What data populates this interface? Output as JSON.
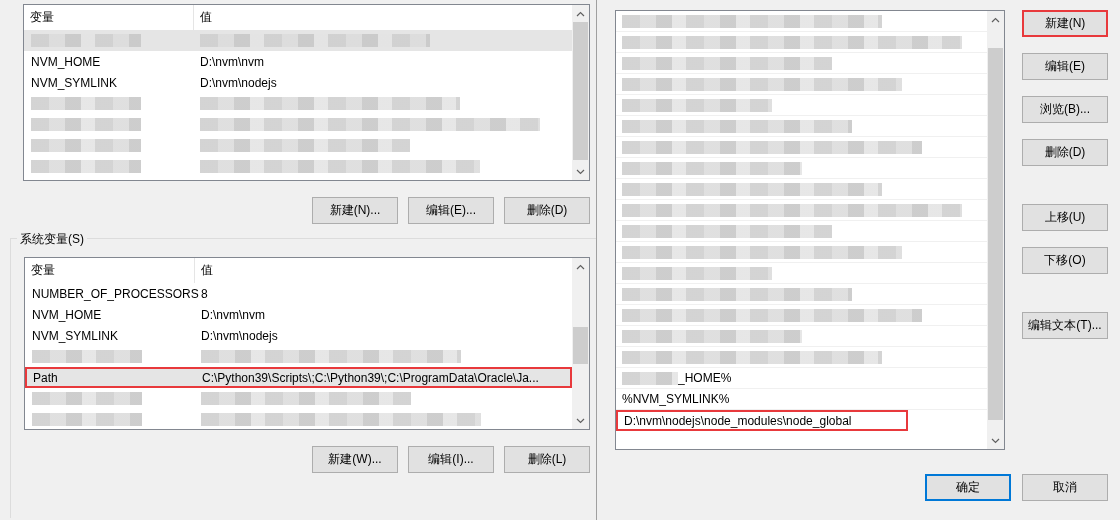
{
  "user_vars": {
    "columns": [
      "变量",
      "值"
    ],
    "rows": [
      {
        "kind": "redacted",
        "selected": true
      },
      {
        "kind": "text",
        "name": "NVM_HOME",
        "value": "D:\\nvm\\nvm",
        "selected": false,
        "highlighted": false
      },
      {
        "kind": "text",
        "name": "NVM_SYMLINK",
        "value": "D:\\nvm\\nodejs",
        "selected": false,
        "highlighted": false
      },
      {
        "kind": "redacted",
        "selected": false
      },
      {
        "kind": "redacted",
        "selected": false
      },
      {
        "kind": "redacted",
        "selected": false
      },
      {
        "kind": "redacted",
        "selected": false
      }
    ],
    "buttons": [
      "新建(N)...",
      "编辑(E)...",
      "删除(D)"
    ]
  },
  "system_vars": {
    "title": "系统变量(S)",
    "columns": [
      "变量",
      "值"
    ],
    "rows": [
      {
        "kind": "text",
        "name": "NUMBER_OF_PROCESSORS",
        "value": "8",
        "selected": false,
        "highlighted": false
      },
      {
        "kind": "text",
        "name": "NVM_HOME",
        "value": "D:\\nvm\\nvm",
        "selected": false,
        "highlighted": false
      },
      {
        "kind": "text",
        "name": "NVM_SYMLINK",
        "value": "D:\\nvm\\nodejs",
        "selected": false,
        "highlighted": false
      },
      {
        "kind": "redacted",
        "selected": false
      },
      {
        "kind": "text",
        "name": "Path",
        "value": "C:\\Python39\\Scripts\\;C:\\Python39\\;C:\\ProgramData\\Oracle\\Ja...",
        "selected": true,
        "highlighted": true
      },
      {
        "kind": "redacted",
        "selected": false
      },
      {
        "kind": "redacted",
        "selected": false
      }
    ],
    "buttons": [
      "新建(W)...",
      "编辑(I)...",
      "删除(L)"
    ]
  },
  "edit_dialog": {
    "entries": [
      {
        "kind": "redacted"
      },
      {
        "kind": "redacted"
      },
      {
        "kind": "redacted"
      },
      {
        "kind": "redacted"
      },
      {
        "kind": "redacted"
      },
      {
        "kind": "redacted"
      },
      {
        "kind": "redacted"
      },
      {
        "kind": "redacted"
      },
      {
        "kind": "redacted"
      },
      {
        "kind": "redacted"
      },
      {
        "kind": "redacted"
      },
      {
        "kind": "redacted"
      },
      {
        "kind": "redacted"
      },
      {
        "kind": "redacted"
      },
      {
        "kind": "redacted"
      },
      {
        "kind": "redacted"
      },
      {
        "kind": "redacted"
      },
      {
        "kind": "partial",
        "text": "_HOME%",
        "highlighted": false
      },
      {
        "kind": "text",
        "text": "%NVM_SYMLINK%",
        "highlighted": false
      },
      {
        "kind": "text",
        "text": "D:\\nvm\\nodejs\\node_modules\\node_global",
        "highlighted": true
      }
    ],
    "side_button_groups": [
      [
        {
          "label": "新建(N)",
          "highlighted": true
        },
        {
          "label": "编辑(E)",
          "highlighted": false
        },
        {
          "label": "浏览(B)...",
          "highlighted": false
        },
        {
          "label": "删除(D)",
          "highlighted": false
        }
      ],
      [
        {
          "label": "上移(U)",
          "highlighted": false
        },
        {
          "label": "下移(O)",
          "highlighted": false
        }
      ],
      [
        {
          "label": "编辑文本(T)...",
          "highlighted": false
        }
      ]
    ],
    "footer_buttons": [
      {
        "label": "确定",
        "default": true
      },
      {
        "label": "取消",
        "default": false
      }
    ]
  }
}
